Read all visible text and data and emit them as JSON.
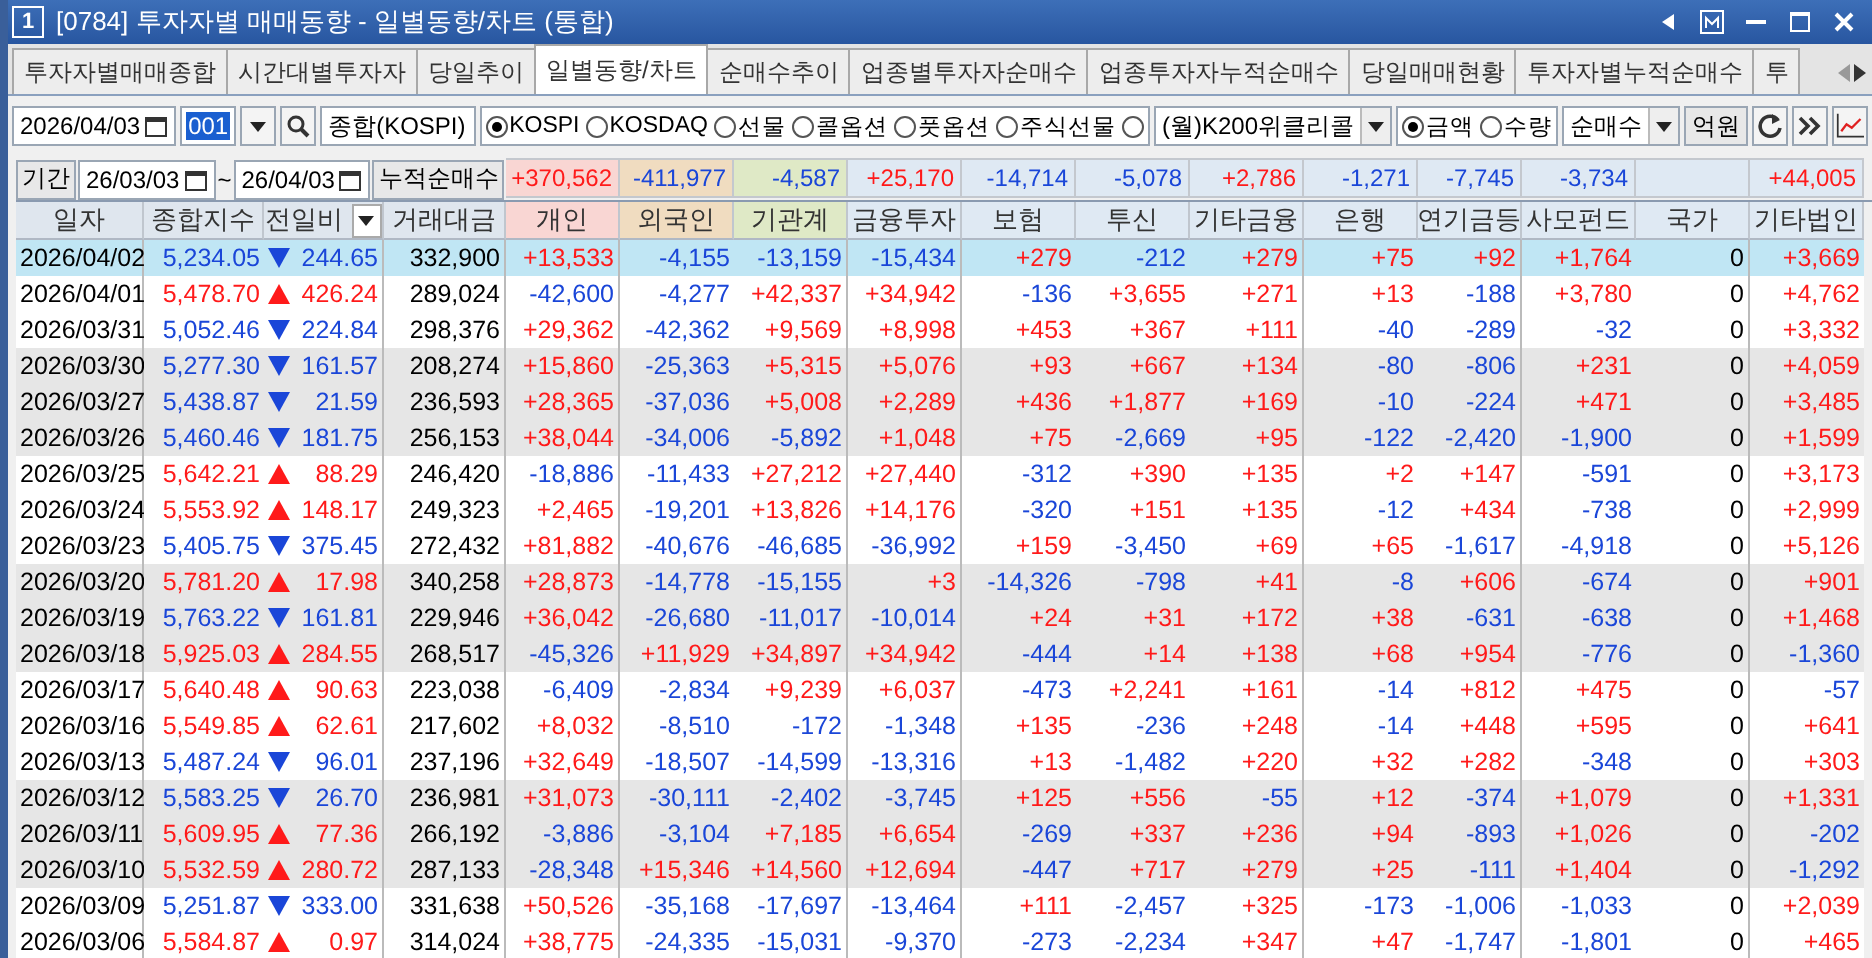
{
  "window": {
    "badge": "1",
    "title": "[0784] 투자자별 매매동향 - 일별동향/차트 (통합)"
  },
  "tabs": [
    {
      "label": "투자자별매매종합",
      "selected": false
    },
    {
      "label": "시간대별투자자",
      "selected": false
    },
    {
      "label": "당일추이",
      "selected": false
    },
    {
      "label": "일별동향/차트",
      "selected": true
    },
    {
      "label": "순매수추이",
      "selected": false
    },
    {
      "label": "업종별투자자순매수",
      "selected": false
    },
    {
      "label": "업종투자자누적순매수",
      "selected": false
    },
    {
      "label": "당일매매현황",
      "selected": false
    },
    {
      "label": "투자자별누적순매수",
      "selected": false
    },
    {
      "label": "투",
      "selected": false
    }
  ],
  "toolbar": {
    "date": "2026/04/03",
    "code": "001",
    "name": "종합(KOSPI)",
    "markets": [
      {
        "label": "KOSPI",
        "selected": true
      },
      {
        "label": "KOSDAQ",
        "selected": false
      },
      {
        "label": "선물",
        "selected": false
      },
      {
        "label": "콜옵션",
        "selected": false
      },
      {
        "label": "풋옵션",
        "selected": false
      },
      {
        "label": "주식선물",
        "selected": false
      }
    ],
    "weekly": {
      "selected": false,
      "value": "(월)K200위클리콜"
    },
    "units": [
      {
        "label": "금액",
        "selected": true
      },
      {
        "label": "수량",
        "selected": false
      }
    ],
    "mode": "순매수",
    "unit_label": "억원"
  },
  "summary": {
    "label": "기간",
    "from": "26/03/03",
    "separator": "~",
    "to": "26/04/03",
    "title": "누적순매수"
  },
  "columns": [
    {
      "label": "일자",
      "color": "#dfe6ee"
    },
    {
      "label": "종합지수",
      "color": "#dfe6ee"
    },
    {
      "label": "전일비",
      "color": "#dfe6ee",
      "sortable": true
    },
    {
      "label": "거래대금",
      "color": "#dfe6ee"
    },
    {
      "label": "개인",
      "color": "#f9d6d3",
      "summary": "+370,562"
    },
    {
      "label": "외국인",
      "color": "#f0dcc0",
      "summary": "-411,977"
    },
    {
      "label": "기관계",
      "color": "#dfe9c6",
      "summary": "-4,587"
    },
    {
      "label": "금융투자",
      "color": "#dfe9f3",
      "summary": "+25,170"
    },
    {
      "label": "보험",
      "color": "#dfe9f3",
      "summary": "-14,714"
    },
    {
      "label": "투신",
      "color": "#dfe9f3",
      "summary": "-5,078"
    },
    {
      "label": "기타금융",
      "color": "#dfe9f3",
      "summary": "+2,786"
    },
    {
      "label": "은행",
      "color": "#dfe9f3",
      "summary": "-1,271"
    },
    {
      "label": "연기금등",
      "color": "#dfe9f3",
      "summary": "-7,745"
    },
    {
      "label": "사모펀드",
      "color": "#dfe9f3",
      "summary": "-3,734"
    },
    {
      "label": "국가",
      "color": "#dfe9f3"
    },
    {
      "label": "기타법인",
      "color": "#dfe9f3",
      "summary": "+44,005"
    }
  ],
  "rows": [
    {
      "date": "2026/04/02",
      "index": "5,234.05",
      "rising": false,
      "change": "244.65",
      "amount": "332,900",
      "selected": true,
      "shaded": false,
      "values": [
        "+13,533",
        "-4,155",
        "-13,159",
        "-15,434",
        "+279",
        "-212",
        "+279",
        "+75",
        "+92",
        "+1,764",
        "0",
        "+3,669"
      ]
    },
    {
      "date": "2026/04/01",
      "index": "5,478.70",
      "rising": true,
      "change": "426.24",
      "amount": "289,024",
      "selected": false,
      "shaded": false,
      "values": [
        "-42,600",
        "-4,277",
        "+42,337",
        "+34,942",
        "-136",
        "+3,655",
        "+271",
        "+13",
        "-188",
        "+3,780",
        "0",
        "+4,762"
      ]
    },
    {
      "date": "2026/03/31",
      "index": "5,052.46",
      "rising": false,
      "change": "224.84",
      "amount": "298,376",
      "selected": false,
      "shaded": false,
      "values": [
        "+29,362",
        "-42,362",
        "+9,569",
        "+8,998",
        "+453",
        "+367",
        "+111",
        "-40",
        "-289",
        "-32",
        "0",
        "+3,332"
      ]
    },
    {
      "date": "2026/03/30",
      "index": "5,277.30",
      "rising": false,
      "change": "161.57",
      "amount": "208,274",
      "selected": false,
      "shaded": true,
      "values": [
        "+15,860",
        "-25,363",
        "+5,315",
        "+5,076",
        "+93",
        "+667",
        "+134",
        "-80",
        "-806",
        "+231",
        "0",
        "+4,059"
      ]
    },
    {
      "date": "2026/03/27",
      "index": "5,438.87",
      "rising": false,
      "change": "21.59",
      "amount": "236,593",
      "selected": false,
      "shaded": true,
      "values": [
        "+28,365",
        "-37,036",
        "+5,008",
        "+2,289",
        "+436",
        "+1,877",
        "+169",
        "-10",
        "-224",
        "+471",
        "0",
        "+3,485"
      ]
    },
    {
      "date": "2026/03/26",
      "index": "5,460.46",
      "rising": false,
      "change": "181.75",
      "amount": "256,153",
      "selected": false,
      "shaded": true,
      "values": [
        "+38,044",
        "-34,006",
        "-5,892",
        "+1,048",
        "+75",
        "-2,669",
        "+95",
        "-122",
        "-2,420",
        "-1,900",
        "0",
        "+1,599"
      ]
    },
    {
      "date": "2026/03/25",
      "index": "5,642.21",
      "rising": true,
      "change": "88.29",
      "amount": "246,420",
      "selected": false,
      "shaded": false,
      "values": [
        "-18,886",
        "-11,433",
        "+27,212",
        "+27,440",
        "-312",
        "+390",
        "+135",
        "+2",
        "+147",
        "-591",
        "0",
        "+3,173"
      ]
    },
    {
      "date": "2026/03/24",
      "index": "5,553.92",
      "rising": true,
      "change": "148.17",
      "amount": "249,323",
      "selected": false,
      "shaded": false,
      "values": [
        "+2,465",
        "-19,201",
        "+13,826",
        "+14,176",
        "-320",
        "+151",
        "+135",
        "-12",
        "+434",
        "-738",
        "0",
        "+2,999"
      ]
    },
    {
      "date": "2026/03/23",
      "index": "5,405.75",
      "rising": false,
      "change": "375.45",
      "amount": "272,432",
      "selected": false,
      "shaded": false,
      "values": [
        "+81,882",
        "-40,676",
        "-46,685",
        "-36,992",
        "+159",
        "-3,450",
        "+69",
        "+65",
        "-1,617",
        "-4,918",
        "0",
        "+5,126"
      ]
    },
    {
      "date": "2026/03/20",
      "index": "5,781.20",
      "rising": true,
      "change": "17.98",
      "amount": "340,258",
      "selected": false,
      "shaded": true,
      "values": [
        "+28,873",
        "-14,778",
        "-15,155",
        "+3",
        "-14,326",
        "-798",
        "+41",
        "-8",
        "+606",
        "-674",
        "0",
        "+901"
      ]
    },
    {
      "date": "2026/03/19",
      "index": "5,763.22",
      "rising": false,
      "change": "161.81",
      "amount": "229,946",
      "selected": false,
      "shaded": true,
      "values": [
        "+36,042",
        "-26,680",
        "-11,017",
        "-10,014",
        "+24",
        "+31",
        "+172",
        "+38",
        "-631",
        "-638",
        "0",
        "+1,468"
      ]
    },
    {
      "date": "2026/03/18",
      "index": "5,925.03",
      "rising": true,
      "change": "284.55",
      "amount": "268,517",
      "selected": false,
      "shaded": true,
      "values": [
        "-45,326",
        "+11,929",
        "+34,897",
        "+34,942",
        "-444",
        "+14",
        "+138",
        "+68",
        "+954",
        "-776",
        "0",
        "-1,360"
      ]
    },
    {
      "date": "2026/03/17",
      "index": "5,640.48",
      "rising": true,
      "change": "90.63",
      "amount": "223,038",
      "selected": false,
      "shaded": false,
      "values": [
        "-6,409",
        "-2,834",
        "+9,239",
        "+6,037",
        "-473",
        "+2,241",
        "+161",
        "-14",
        "+812",
        "+475",
        "0",
        "-57"
      ]
    },
    {
      "date": "2026/03/16",
      "index": "5,549.85",
      "rising": true,
      "change": "62.61",
      "amount": "217,602",
      "selected": false,
      "shaded": false,
      "values": [
        "+8,032",
        "-8,510",
        "-172",
        "-1,348",
        "+135",
        "-236",
        "+248",
        "-14",
        "+448",
        "+595",
        "0",
        "+641"
      ]
    },
    {
      "date": "2026/03/13",
      "index": "5,487.24",
      "rising": false,
      "change": "96.01",
      "amount": "237,196",
      "selected": false,
      "shaded": false,
      "values": [
        "+32,649",
        "-18,507",
        "-14,599",
        "-13,316",
        "+13",
        "-1,482",
        "+220",
        "+32",
        "+282",
        "-348",
        "0",
        "+303"
      ]
    },
    {
      "date": "2026/03/12",
      "index": "5,583.25",
      "rising": false,
      "change": "26.70",
      "amount": "236,981",
      "selected": false,
      "shaded": true,
      "values": [
        "+31,073",
        "-30,111",
        "-2,402",
        "-3,745",
        "+125",
        "+556",
        "-55",
        "+12",
        "-374",
        "+1,079",
        "0",
        "+1,331"
      ]
    },
    {
      "date": "2026/03/11",
      "index": "5,609.95",
      "rising": true,
      "change": "77.36",
      "amount": "266,192",
      "selected": false,
      "shaded": true,
      "values": [
        "-3,886",
        "-3,104",
        "+7,185",
        "+6,654",
        "-269",
        "+337",
        "+236",
        "+94",
        "-893",
        "+1,026",
        "0",
        "-202"
      ]
    },
    {
      "date": "2026/03/10",
      "index": "5,532.59",
      "rising": true,
      "change": "280.72",
      "amount": "287,133",
      "selected": false,
      "shaded": true,
      "values": [
        "-28,348",
        "+15,346",
        "+14,560",
        "+12,694",
        "-447",
        "+717",
        "+279",
        "+25",
        "-111",
        "+1,404",
        "0",
        "-1,292"
      ]
    },
    {
      "date": "2026/03/09",
      "index": "5,251.87",
      "rising": false,
      "change": "333.00",
      "amount": "331,638",
      "selected": false,
      "shaded": false,
      "values": [
        "+50,526",
        "-35,168",
        "-17,697",
        "-13,464",
        "+111",
        "-2,457",
        "+325",
        "-173",
        "-1,006",
        "-1,033",
        "0",
        "+2,039"
      ]
    },
    {
      "date": "2026/03/06",
      "index": "5,584.87",
      "rising": true,
      "change": "0.97",
      "amount": "314,024",
      "selected": false,
      "shaded": false,
      "values": [
        "+38,775",
        "-24,335",
        "-15,031",
        "-9,370",
        "-273",
        "-2,234",
        "+347",
        "+47",
        "-1,747",
        "-1,801",
        "0",
        "+465"
      ]
    }
  ]
}
